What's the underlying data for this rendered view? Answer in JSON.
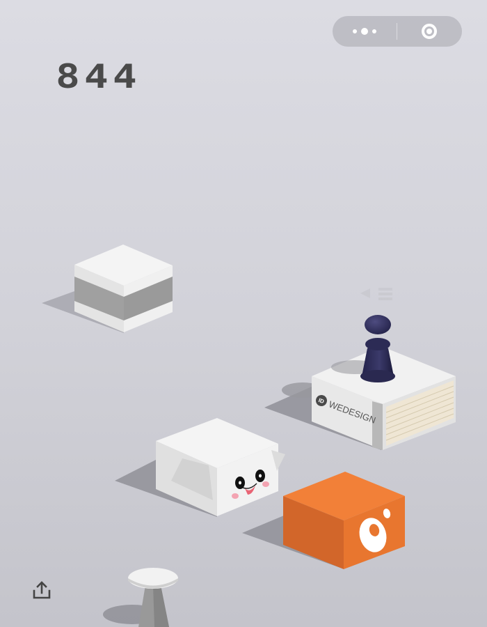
{
  "game": {
    "score": "844"
  },
  "capsule": {
    "menu_icon": "more-dots-icon",
    "close_icon": "target-circle-icon"
  },
  "share": {
    "icon": "share-upload-icon"
  },
  "blocks": {
    "wedesign_label": "WEDESIGN",
    "wedesign_logo_text": "ID"
  },
  "colors": {
    "background": "#d6d6dd",
    "score": "#4a4a4a",
    "player": "#2e2d52",
    "orange_block": "#f08038"
  }
}
